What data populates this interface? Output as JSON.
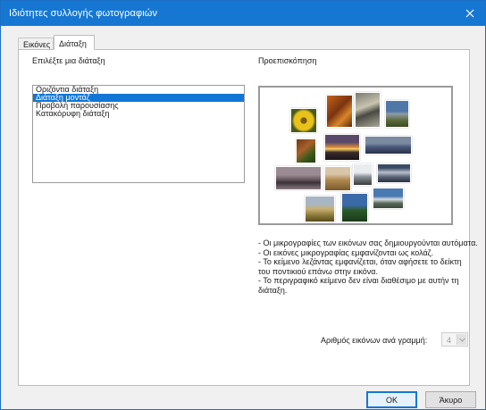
{
  "window": {
    "title": "Ιδιότητες συλλογής φωτογραφιών",
    "close_icon": "close-icon"
  },
  "tabs": [
    {
      "label": "Εικόνες",
      "active": false
    },
    {
      "label": "Διάταξη",
      "active": true
    }
  ],
  "layout_section": {
    "label": "Επιλέξτε μια διάταξη",
    "options": [
      {
        "label": "Οριζόντια διάταξη",
        "selected": false
      },
      {
        "label": "Διάταξη μοντάζ",
        "selected": true
      },
      {
        "label": "Προβολή παρουσίασης",
        "selected": false
      },
      {
        "label": "Κατακόρυφη διάταξη",
        "selected": false
      }
    ]
  },
  "preview": {
    "label": "Προεπισκόπηση"
  },
  "description": {
    "lines": [
      "- Οι μικρογραφίες των εικόνων σας δημιουργούνται αυτόματα.",
      "- Οι εικόνες μικρογραφίας εμφανίζονται ως κολάζ.",
      "- Το κείμενο λεζάντας εμφανίζεται, όταν αφήσετε το δείκτη",
      "του ποντικιού επάνω στην εικόνα.",
      "- Το περιγραφικό κείμενο δεν είναι διαθέσιμο με αυτήν τη",
      "διάταξη."
    ]
  },
  "images_per_row": {
    "label": "Αριθμός εικόνων ανά γραμμή:",
    "value": "4",
    "enabled": false
  },
  "buttons": {
    "ok": "OK",
    "cancel": "Άκυρο"
  },
  "colors": {
    "titlebar": "#1677d2",
    "selection": "#1276d6"
  }
}
